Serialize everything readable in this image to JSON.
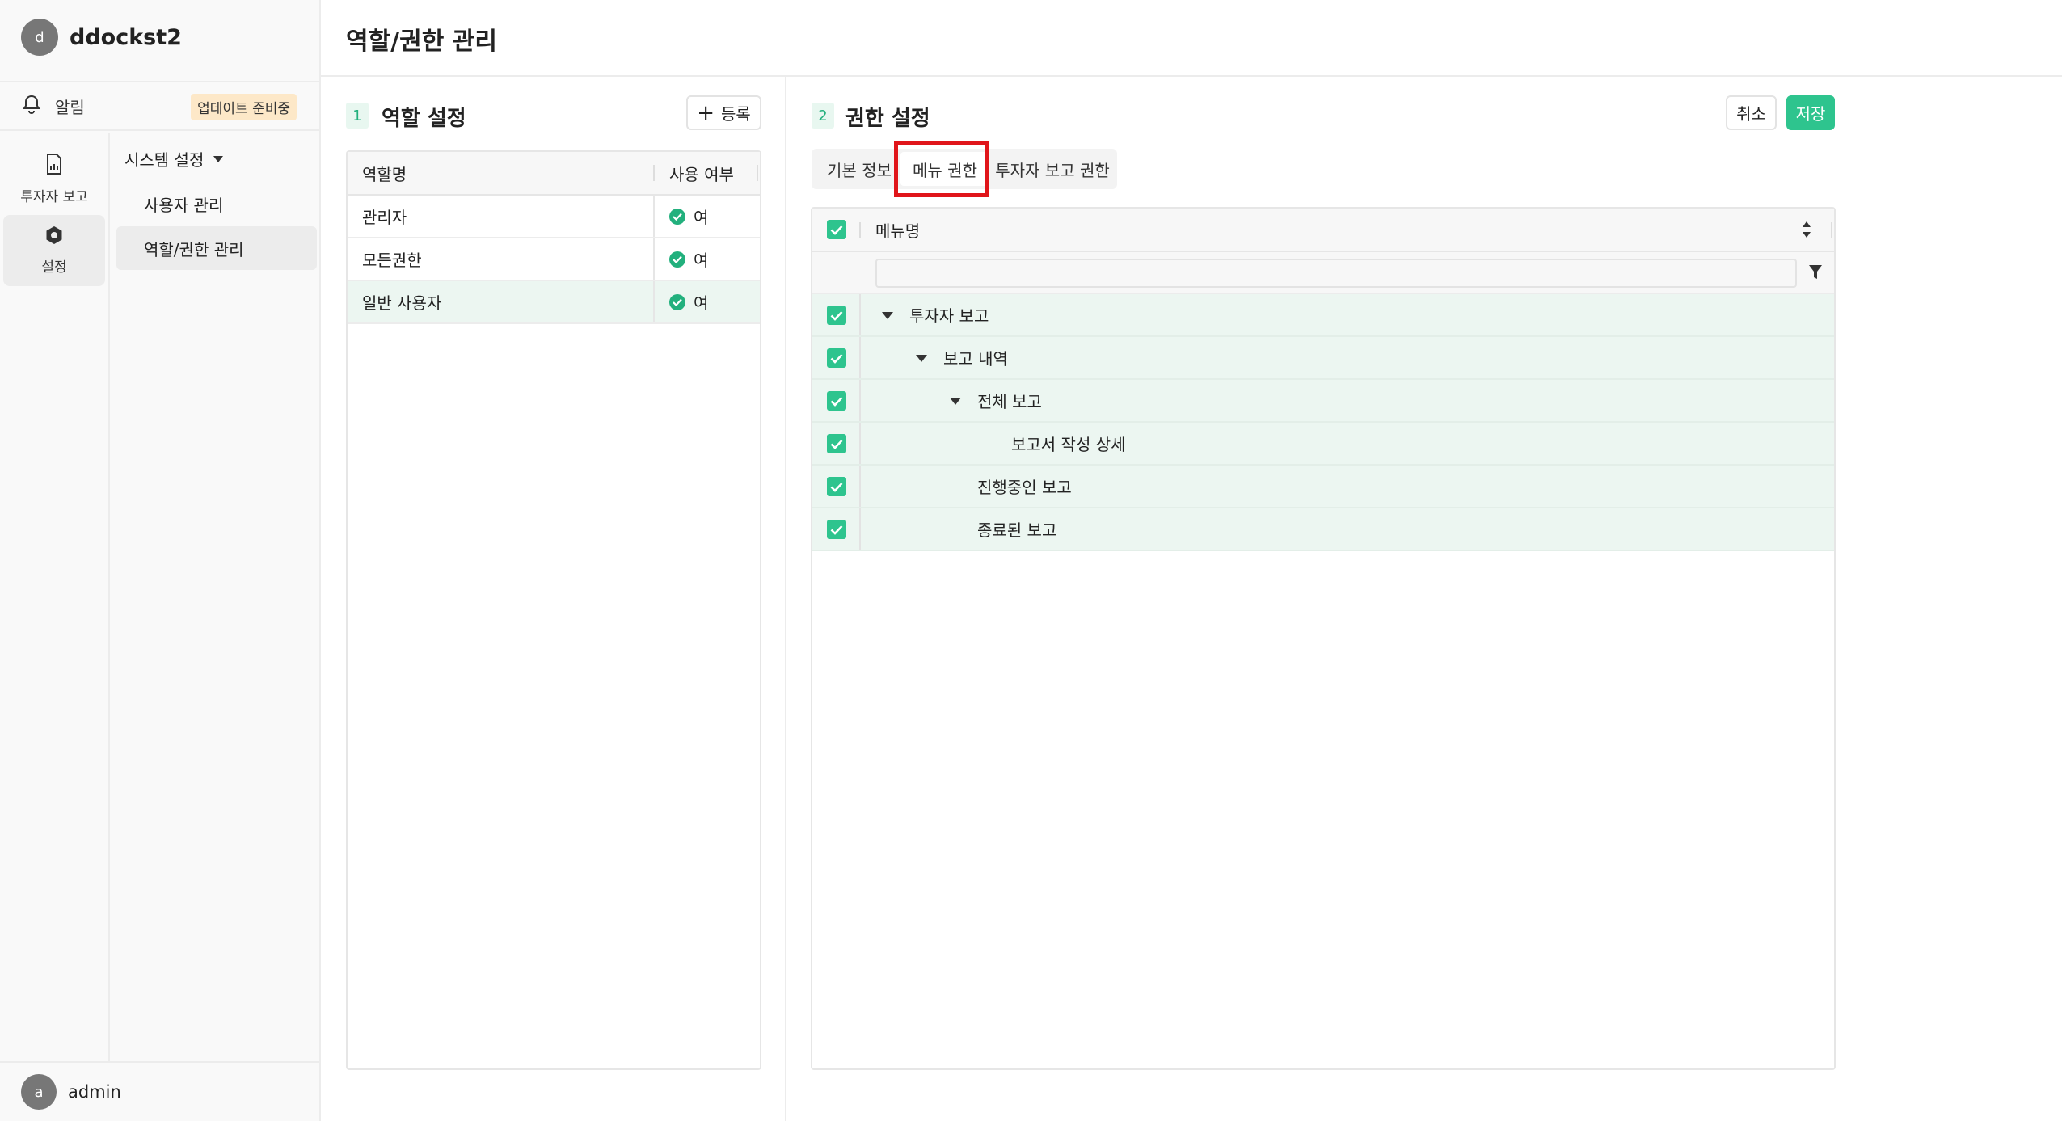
{
  "sidebar": {
    "workspace_avatar": "d",
    "workspace_name": "ddockst2",
    "notification_label": "알림",
    "update_badge": "업데이트 준비중",
    "rail": [
      {
        "label": "투자자 보고",
        "icon": "report-icon"
      },
      {
        "label": "설정",
        "icon": "gear-icon"
      }
    ],
    "submenu_title": "시스템 설정",
    "submenu_items": [
      "사용자 관리",
      "역할/권한 관리"
    ],
    "user_avatar": "a",
    "user_name": "admin"
  },
  "header": {
    "title": "역할/권한 관리"
  },
  "roles_section": {
    "number": "1",
    "title": "역할 설정",
    "add_button": "등록",
    "columns": [
      "역할명",
      "사용 여부"
    ],
    "rows": [
      {
        "name": "관리자",
        "enabled": "여"
      },
      {
        "name": "모든권한",
        "enabled": "여"
      },
      {
        "name": "일반 사용자",
        "enabled": "여"
      }
    ],
    "selected_row": 2
  },
  "permissions_section": {
    "number": "2",
    "title": "권한 설정",
    "cancel_button": "취소",
    "save_button": "저장",
    "tabs": [
      "기본 정보",
      "메뉴 권한",
      "투자자 보고 권한"
    ],
    "active_tab": 1,
    "column_header": "메뉴명",
    "filter_placeholder": "",
    "tree": [
      {
        "label": "투자자 보고",
        "level": 0,
        "expanded": true,
        "checked": true
      },
      {
        "label": "보고 내역",
        "level": 1,
        "expanded": true,
        "checked": true
      },
      {
        "label": "전체 보고",
        "level": 2,
        "expanded": true,
        "checked": true
      },
      {
        "label": "보고서 작성 상세",
        "level": 3,
        "expanded": false,
        "checked": true
      },
      {
        "label": "진행중인 보고",
        "level": 2,
        "expanded": false,
        "checked": true
      },
      {
        "label": "종료된 보고",
        "level": 2,
        "expanded": false,
        "checked": true
      }
    ]
  },
  "colors": {
    "accent": "#2ec48e",
    "highlight": "#e0151a",
    "selected_row": "#ecf6f1"
  }
}
